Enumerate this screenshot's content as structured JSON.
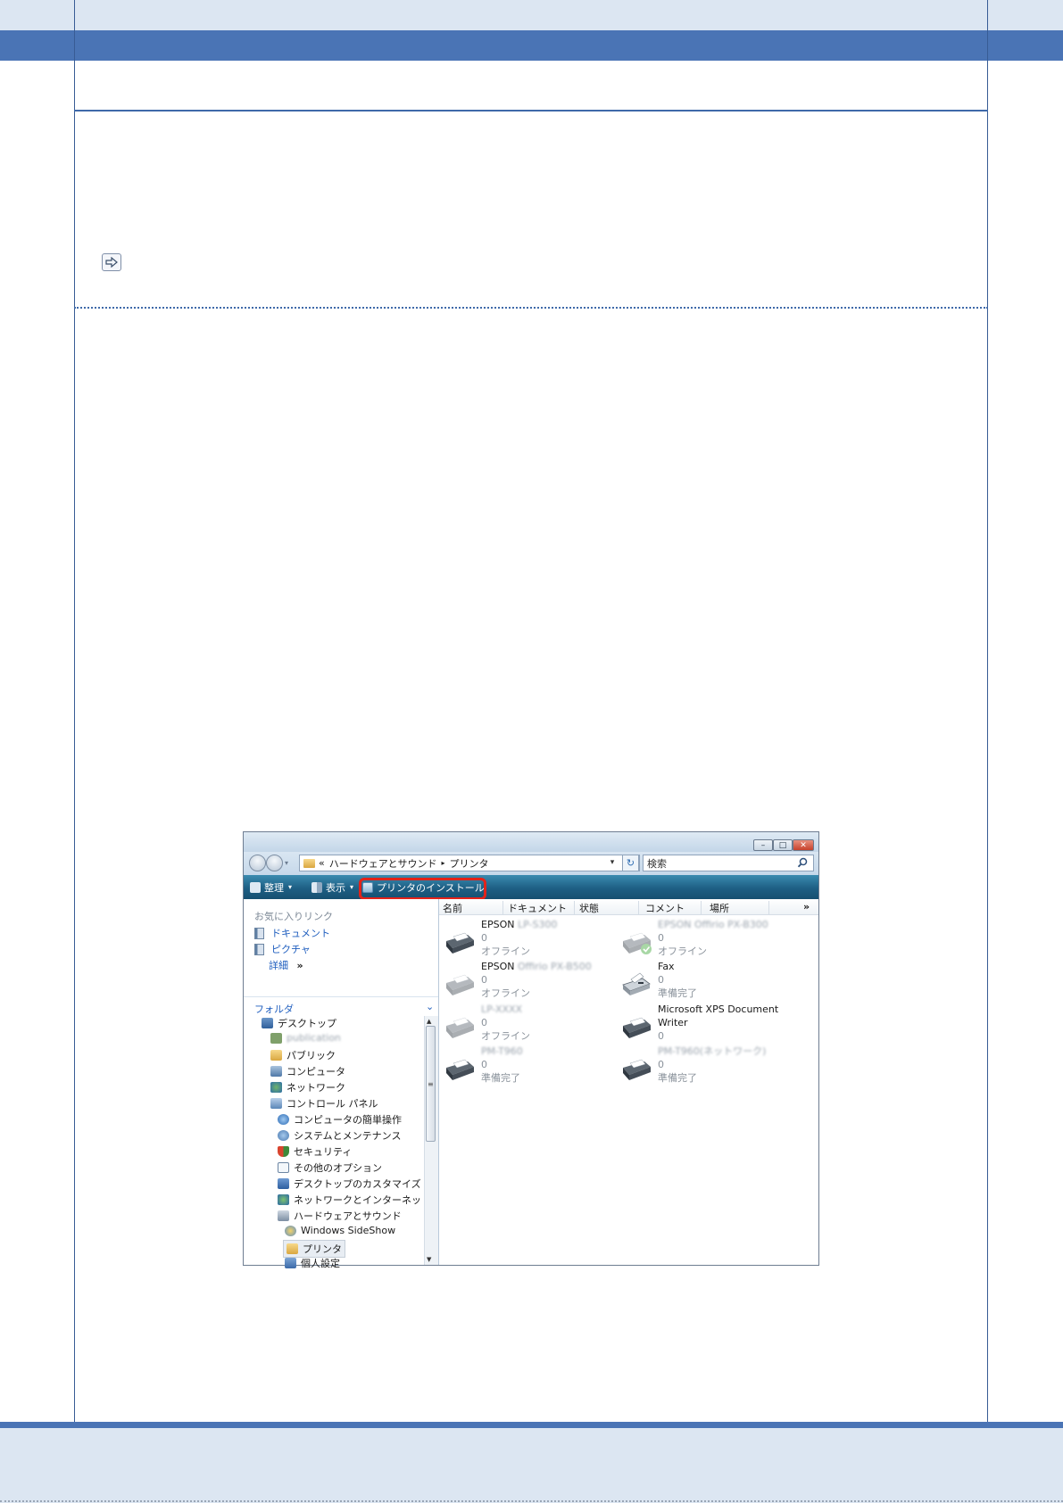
{
  "window": {
    "address": {
      "separator": "«",
      "crumb1": "ハードウェアとサウンド",
      "arrow": "▸",
      "crumb2": "プリンタ"
    },
    "search_placeholder": "検索",
    "toolbar": {
      "organize": "整理",
      "view": "表示",
      "install_printer": "プリンタのインストール"
    },
    "favorites": {
      "title": "お気に入りリンク",
      "items": [
        "ドキュメント",
        "ピクチャ"
      ],
      "more": "詳細",
      "more_glyph": "»"
    },
    "folders": {
      "title": "フォルダ",
      "items": [
        "デスクトップ",
        "publication",
        "パブリック",
        "コンピュータ",
        "ネットワーク",
        "コントロール パネル",
        "コンピュータの簡単操作",
        "システムとメンテナンス",
        "セキュリティ",
        "その他のオプション",
        "デスクトップのカスタマイズ",
        "ネットワークとインターネット",
        "ハードウェアとサウンド",
        "Windows SideShow",
        "プリンタ",
        "個人設定"
      ]
    },
    "columns": [
      "名前",
      "ドキュメント",
      "状態",
      "コメント",
      "場所"
    ],
    "columns_more": "»",
    "printers": [
      {
        "name": "EPSON",
        "model": "LP-S300",
        "docs": "0",
        "status": "オフライン"
      },
      {
        "name": "",
        "model": "EPSON Offirio PX-B300",
        "docs": "0",
        "status": "オフライン"
      },
      {
        "name": "EPSON",
        "model": "Offirio PX-B500",
        "docs": "0",
        "status": "オフライン"
      },
      {
        "name": "Fax",
        "model": "",
        "docs": "0",
        "status": "準備完了"
      },
      {
        "name": "",
        "model": "LP-XXXX",
        "docs": "0",
        "status": "オフライン"
      },
      {
        "name": "Microsoft XPS Document",
        "name2": "Writer",
        "docs": "0",
        "status": ""
      },
      {
        "name": "",
        "model": "PM-T960",
        "docs": "0",
        "status": "準備完了"
      },
      {
        "name": "",
        "model": "PM-T960(ネットワーク)",
        "docs": "0",
        "status": "準備完了"
      }
    ]
  },
  "colors": {
    "frame_blue": "#4a74b5",
    "band": "#dce6f2",
    "highlight_red": "#e2231a",
    "link_blue": "#1f5ebf"
  }
}
